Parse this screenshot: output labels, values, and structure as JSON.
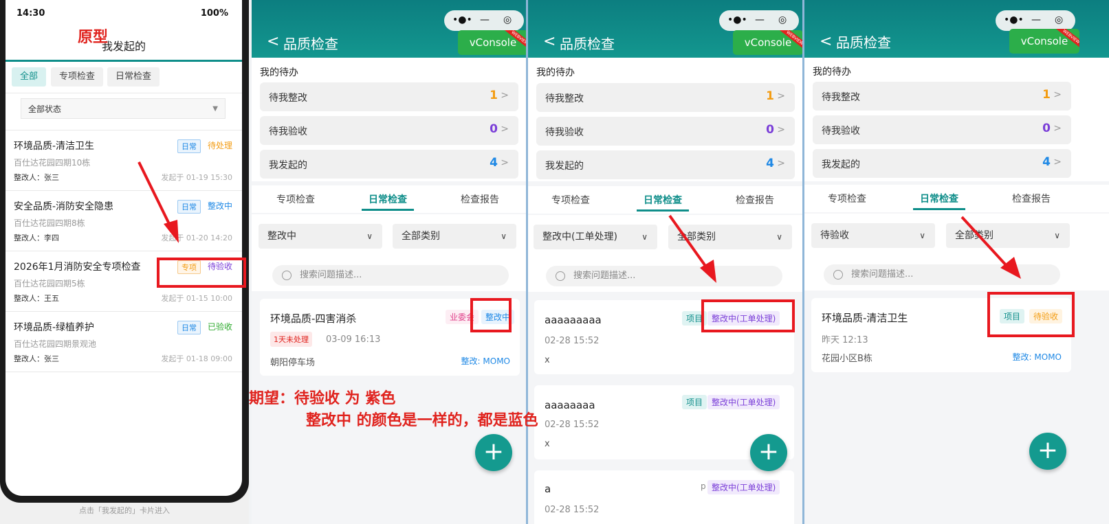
{
  "prototype": {
    "label": "原型",
    "status_time": "14:30",
    "battery": "100%",
    "title": "我发起的",
    "tabs": [
      "全部",
      "专项检查",
      "日常检查"
    ],
    "status_filter": "全部状态",
    "items": [
      {
        "title": "环境品质-清洁卫生",
        "tag": "日常",
        "status": "待处理",
        "location": "百仕达花园四期10栋",
        "person": "整改人：张三",
        "date": "发起于 01-19 15:30"
      },
      {
        "title": "安全品质-消防安全隐患",
        "tag": "日常",
        "status": "整改中",
        "location": "百仕达花园四期8栋",
        "person": "整改人：李四",
        "date": "发起于 01-20 14:20"
      },
      {
        "title": "2026年1月消防安全专项检查",
        "tag": "专项",
        "status": "待验收",
        "location": "百仕达花园四期5栋",
        "person": "整改人：王五",
        "date": "发起于 01-15 10:00"
      },
      {
        "title": "环境品质-绿植养护",
        "tag": "日常",
        "status": "已验收",
        "location": "百仕达花园四期景观池",
        "person": "整改人：张三",
        "date": "发起于 01-18 09:00"
      }
    ],
    "footer": "点击「我发起的」卡片进入"
  },
  "expectation": {
    "line1": "期望：待验收 为 紫色",
    "line2": "整改中  的颜色是一样的，都是蓝色"
  },
  "common": {
    "back": "<",
    "title": "品质检查",
    "vconsole": "vConsole",
    "ribbon": "WEBVIEW",
    "todo_header": "我的待办",
    "todo": [
      {
        "label": "待我整改",
        "count": "1"
      },
      {
        "label": "待我验收",
        "count": "0"
      },
      {
        "label": "我发起的",
        "count": "4"
      }
    ],
    "tabs": [
      "专项检查",
      "日常检查",
      "检查报告"
    ],
    "category_filter": "全部类别",
    "search_placeholder": "搜索问题描述...",
    "fab": "+",
    "colors": {
      "teal": "#0f8e8a",
      "orange": "#f39c12",
      "purple": "#7b3fd8",
      "blue": "#1e88e5",
      "red": "#e0231e"
    }
  },
  "screen1": {
    "status_filter": "整改中",
    "card": {
      "title": "环境品质-四害消杀",
      "tag1": "业委会",
      "status": "整改中",
      "late": "1天未处理",
      "time": "03-09 16:13",
      "location": "朝阳停车场",
      "owner": "整改: MOMO"
    }
  },
  "screen2": {
    "status_filter": "整改中(工单处理)",
    "cards": [
      {
        "title": "aaaaaaaaa",
        "tag1": "项目",
        "status": "整改中(工单处理)",
        "time": "02-28 15:52",
        "location": "x"
      },
      {
        "title": "aaaaaaaa",
        "tag1": "项目",
        "status": "整改中(工单处理)",
        "time": "02-28 15:52",
        "location": "x"
      },
      {
        "title": "a",
        "tag1": "p",
        "status": "整改中(工单处理)",
        "time": "02-28 15:52"
      }
    ]
  },
  "screen3": {
    "status_filter": "待验收",
    "card": {
      "title": "环境品质-清洁卫生",
      "tag1": "项目",
      "status": "待验收",
      "time": "昨天 12:13",
      "location": "花园小区B栋",
      "owner": "整改: MOMO"
    }
  }
}
